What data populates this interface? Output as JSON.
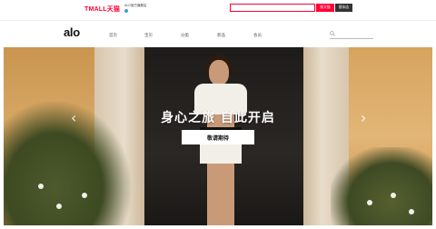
{
  "topbar": {
    "brand": "TMALL天猫",
    "shop_info": "ALO官方旗舰店",
    "search_placeholder": "",
    "search_tmall_label": "搜天猫",
    "search_shop_label": "搜本店"
  },
  "nav": {
    "logo": "alo",
    "items": [
      "首页",
      "宝贝",
      "分类",
      "新品",
      "会员"
    ]
  },
  "hero": {
    "headline": "身心之旅 自此开启",
    "cta": "敬请期待",
    "prev_arrow": "‹",
    "next_arrow": "›"
  },
  "colors": {
    "tmall_red": "#ff0036",
    "text_dark": "#111111"
  }
}
